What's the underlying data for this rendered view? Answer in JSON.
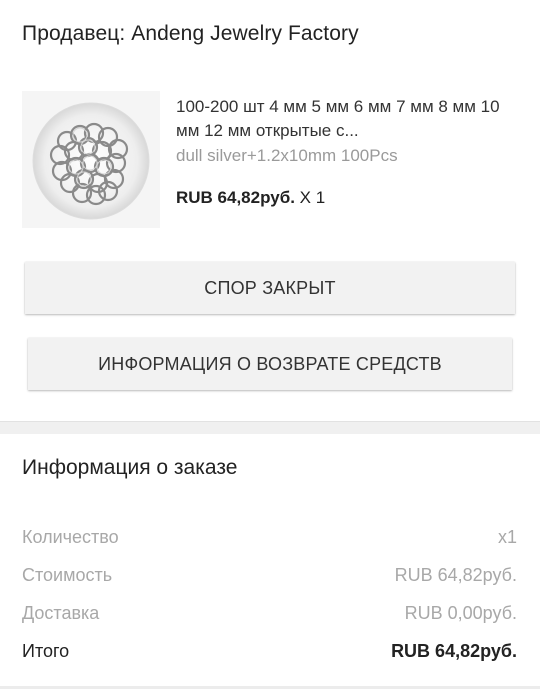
{
  "seller": {
    "label": "Продавец: Andeng Jewelry Factory"
  },
  "product": {
    "image_icon": "metal-jump-rings-photo",
    "title": "100-200 шт 4 мм 5 мм 6 мм 7 мм 8 мм 10 мм 12 мм открытые с...",
    "variant": "dull silver+1.2x10mm 100Pcs",
    "price": "RUB 64,82руб.",
    "quantity": " X 1"
  },
  "buttons": {
    "dispute_closed": "СПОР ЗАКРЫТ",
    "refund_info": "ИНФОРМАЦИЯ О ВОЗВРАТЕ СРЕДСТВ"
  },
  "order_info": {
    "title": "Информация о заказе",
    "rows": [
      {
        "label": "Количество",
        "value": "x1"
      },
      {
        "label": "Стоимость",
        "value": "RUB 64,82руб."
      },
      {
        "label": "Доставка",
        "value": "RUB 0,00руб."
      },
      {
        "label": "Итого",
        "value": "RUB 64,82руб."
      }
    ]
  },
  "colors": {
    "button_bg": "#f2f2f2",
    "muted_text": "#a8a8a8",
    "divider": "#f0f0f0"
  }
}
